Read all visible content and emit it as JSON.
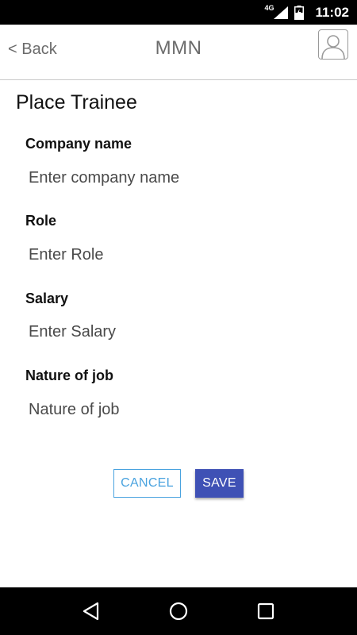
{
  "status_bar": {
    "network": "4G",
    "time": "11:02"
  },
  "header": {
    "back_label": "< Back",
    "title": "MMN"
  },
  "form": {
    "title": "Place Trainee",
    "fields": [
      {
        "label": "Company name",
        "placeholder": "Enter company name"
      },
      {
        "label": "Role",
        "placeholder": "Enter Role"
      },
      {
        "label": "Salary",
        "placeholder": "Enter Salary"
      },
      {
        "label": "Nature of job",
        "placeholder": "Nature of job"
      }
    ],
    "cancel_label": "CANCEL",
    "save_label": "SAVE"
  },
  "icons": {
    "avatar": "user-avatar-icon",
    "back": "nav-back-icon",
    "home": "nav-home-icon",
    "recents": "nav-recents-icon"
  },
  "colors": {
    "accent": "#3f51b5",
    "cancel_border": "#4aa3df"
  }
}
